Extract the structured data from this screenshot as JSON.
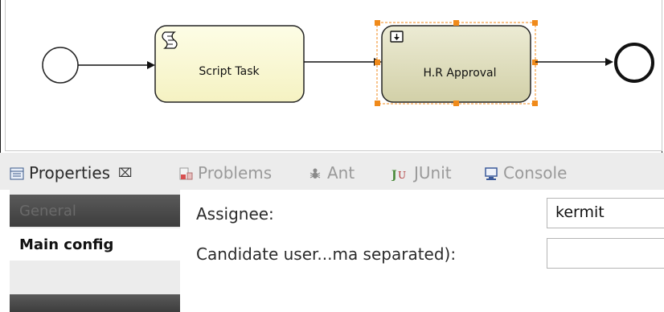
{
  "diagram": {
    "script_task_label": "Script Task",
    "hr_approval_label": "H.R Approval"
  },
  "tabs": [
    {
      "label": "Properties",
      "icon": "properties-icon"
    },
    {
      "label": "Problems",
      "icon": "problems-icon"
    },
    {
      "label": "Ant",
      "icon": "ant-icon"
    },
    {
      "label": "JUnit",
      "icon": "junit-icon"
    },
    {
      "label": "Console",
      "icon": "console-icon"
    }
  ],
  "sidebar": {
    "items": [
      "General",
      "Main config",
      ""
    ]
  },
  "form": {
    "assignee_label": "Assignee:",
    "assignee_value": "kermit",
    "candidate_label": "Candidate user...ma separated):",
    "candidate_value": ""
  }
}
